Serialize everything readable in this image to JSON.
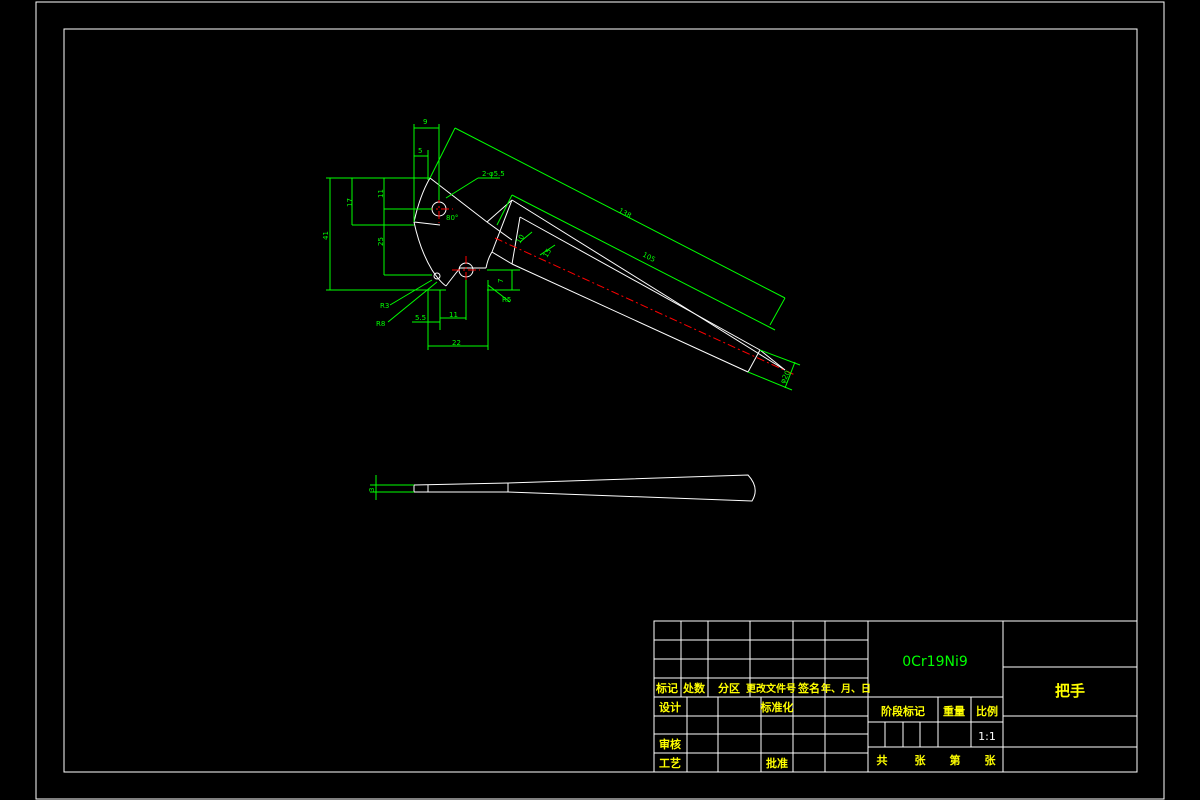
{
  "colors": {
    "background": "#000000",
    "frame": "#ffffff",
    "dimension": "#00ff00",
    "centerline": "#ff0000",
    "title_text": "#ffff00"
  },
  "drawing": {
    "top_view_dimensions": {
      "d9": "9",
      "d5": "5",
      "holes": "2-φ5.5",
      "d138": "138",
      "d105": "105",
      "d17": "17",
      "d11": "11",
      "d41": "41",
      "d25": "25",
      "d80": "80°",
      "d10": "10",
      "d15": "15",
      "d7": "7",
      "r3": "R3",
      "r8": "R8",
      "d5_5": "5.5",
      "d11b": "11",
      "r5": "R5",
      "d22": "22",
      "d20": "φ20"
    },
    "side_view_dimensions": {
      "d3": "3"
    }
  },
  "title_block": {
    "material": "0Cr19Ni9",
    "part_name": "把手",
    "revision_headers": [
      "标记",
      "处数",
      "分区",
      "更改文件号",
      "签名",
      "年、月、日"
    ],
    "design": "设计",
    "standardization": "标准化",
    "review": "审核",
    "process": "工艺",
    "approve": "批准",
    "stage_mark": "阶段标记",
    "weight": "重量",
    "scale": "比例",
    "scale_value": "1:1",
    "total_label": "共",
    "sheets_label": "张",
    "page_label": "第"
  }
}
